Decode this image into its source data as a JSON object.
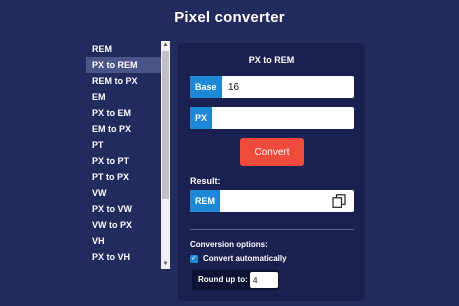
{
  "app": {
    "title": "Pixel converter"
  },
  "sidebar": {
    "items": [
      {
        "label": "REM",
        "label2": ""
      },
      {
        "label": "PX to REM",
        "label2": ""
      },
      {
        "label": "REM to PX",
        "label2": "EM"
      },
      {
        "label": "PX to EM",
        "label2": ""
      },
      {
        "label": "EM to PX",
        "label2": "PT"
      },
      {
        "label": "PX to PT",
        "label2": ""
      },
      {
        "label": "PT to PX",
        "label2": "VW"
      },
      {
        "label": "PX to VW",
        "label2": ""
      },
      {
        "label": "VW to PX",
        "label2": "VH"
      },
      {
        "label": "PX to VH",
        "label2": ""
      }
    ],
    "active_index": 1
  },
  "converter": {
    "title": "PX to REM",
    "base": {
      "label": "Base",
      "value": "16"
    },
    "px": {
      "label": "PX",
      "value": ""
    },
    "convert_label": "Convert",
    "result_label": "Result:",
    "result": {
      "label": "REM",
      "value": ""
    },
    "options": {
      "title": "Conversion options:",
      "auto_label": "Convert automatically",
      "auto_checked": true,
      "round_label": "Round up to:",
      "round_value": "4"
    }
  },
  "colors": {
    "background": "#232b5e",
    "panel": "#1a2150",
    "accent": "#1e88d8",
    "convert": "#f04a3a"
  }
}
